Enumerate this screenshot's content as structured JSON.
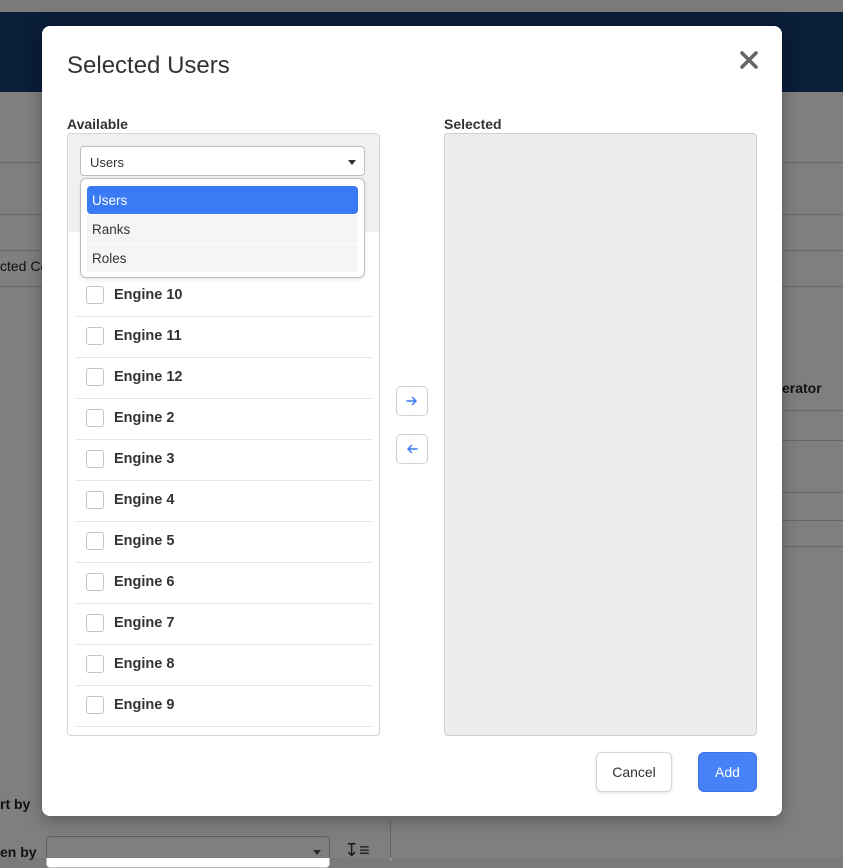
{
  "background": {
    "fragments": [
      "cted Co",
      "erator",
      "rt by",
      "en by"
    ],
    "sort_icon": "sort-descending-icon"
  },
  "modal": {
    "title": "Selected Users",
    "close_icon": "close-icon",
    "available": {
      "label": "Available",
      "type_select": {
        "value": "Users",
        "options": [
          "Users",
          "Ranks",
          "Roles"
        ]
      },
      "items": [
        "Engine 10",
        "Engine 11",
        "Engine 12",
        "Engine 2",
        "Engine 3",
        "Engine 4",
        "Engine 5",
        "Engine 6",
        "Engine 7",
        "Engine 8",
        "Engine 9"
      ]
    },
    "move_right_icon": "arrow-right-icon",
    "move_left_icon": "arrow-left-icon",
    "selected": {
      "label": "Selected"
    },
    "buttons": {
      "cancel": "Cancel",
      "add": "Add"
    }
  },
  "colors": {
    "accent": "#3a7af5",
    "add_button": "#4782f8",
    "header": "#143b73"
  }
}
